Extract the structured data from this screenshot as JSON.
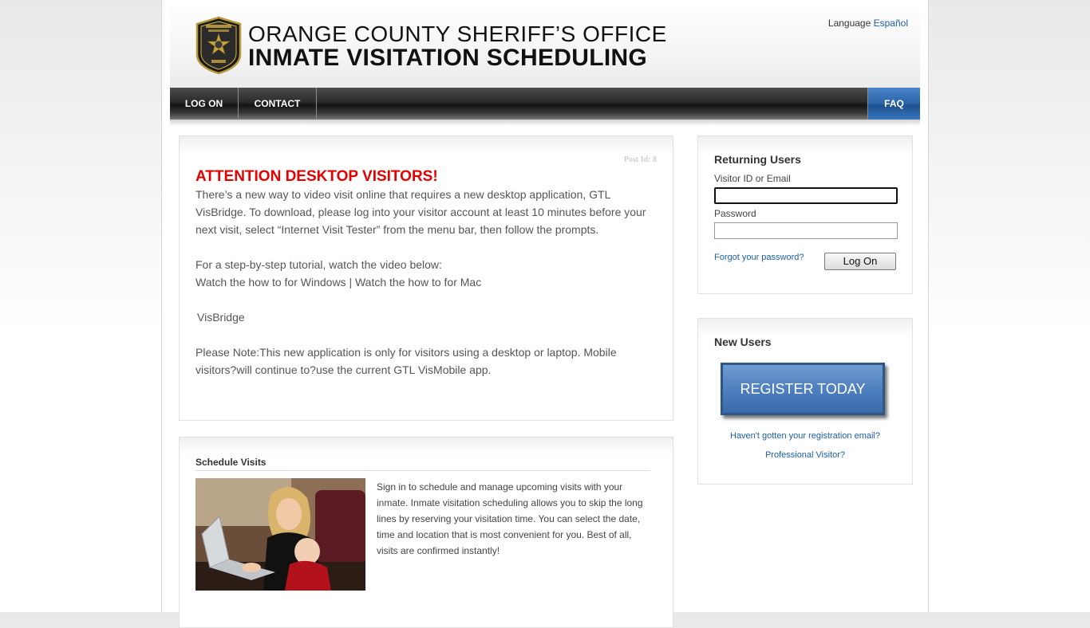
{
  "header": {
    "title_line1": "ORANGE COUNTY SHERIFF’S OFFICE",
    "title_line2": "INMATE VISITATION SCHEDULING",
    "language_label": "Language",
    "language_link": "Español",
    "seal_text": "ORANGE COUNTY SHERIFF'S OFFICE N.Y."
  },
  "nav": {
    "items": [
      {
        "label": "LOG ON"
      },
      {
        "label": "CONTACT"
      }
    ],
    "faq_label": "FAQ"
  },
  "announcement": {
    "post_id": "Post Id: 8",
    "heading": "ATTENTION DESKTOP VISITORS!",
    "paragraph1": "There’s a new way to video visit online that requires a new desktop application, GTL VisBridge. To download, please log into your visitor account at least 10 minutes before your next visit, select “Internet Visit Tester” from the menu bar, then follow the prompts.",
    "paragraph2_line1": "For a step-by-step tutorial, watch the video below:",
    "link_windows": "Watch the how to for Windows",
    "link_separator": " | ",
    "link_mac": "Watch the how to for Mac",
    "image_alt": "VisBridge",
    "note": "Please Note:This new application is only for visitors using a desktop or laptop. Mobile visitors?will continue to?use the current GTL VisMobile app."
  },
  "schedule": {
    "title": "Schedule Visits",
    "text": "Sign in to schedule and manage upcoming visits with your inmate. Inmate visitation scheduling allows you to skip the long lines by reserving your visitation time. You can select the date, time and location that is most convenient for you. Best of all, visits are confirmed instantly!"
  },
  "login": {
    "title": "Returning Users",
    "id_label": "Visitor ID or Email",
    "id_value": "",
    "password_label": "Password",
    "password_value": "",
    "forgot_link": "Forgot your password?",
    "button_label": "Log On"
  },
  "new_users": {
    "title": "New Users",
    "register_label": "REGISTER TODAY",
    "registration_email_link": "Haven't gotten your registration email?",
    "professional_link": "Professional Visitor?"
  },
  "colors": {
    "accent_red": "#e20000",
    "link_blue": "#1a5faa",
    "faq_blue": "#2a63a8"
  }
}
